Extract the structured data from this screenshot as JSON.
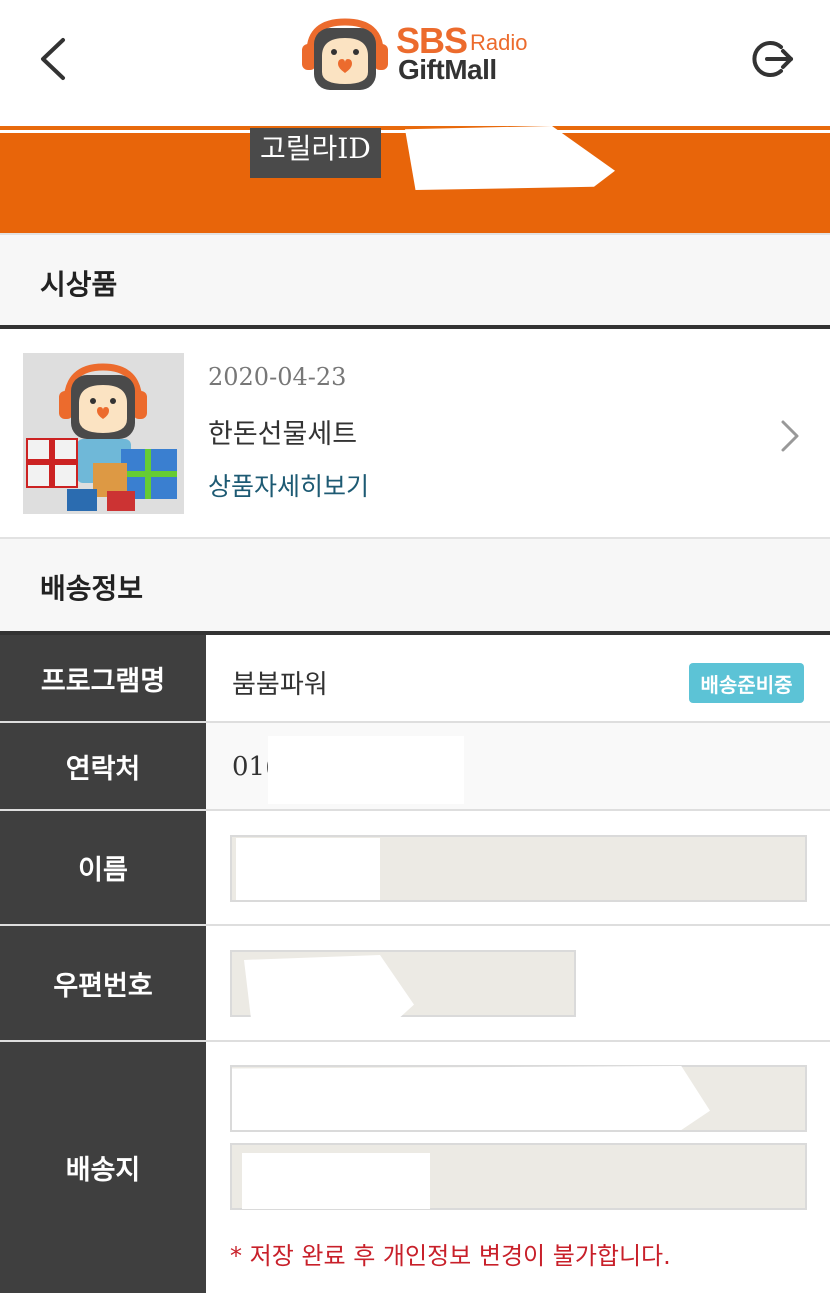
{
  "header": {
    "logo_sbs": "SBS",
    "logo_radio": "Radio",
    "logo_giftmall": "GiftMall",
    "accent_color": "#e8650a"
  },
  "banner": {
    "gorilla_id_label": "고릴라ID"
  },
  "prize_section": {
    "title": "시상품",
    "item": {
      "date": "2020-04-23",
      "name": "한돈선물세트",
      "detail_link": "상품자세히보기"
    }
  },
  "delivery_section": {
    "title": "배송정보",
    "rows": {
      "program": {
        "label": "프로그램명",
        "value": "붐붐파워",
        "status": "배송준비중"
      },
      "contact": {
        "label": "연락처",
        "value": "01("
      },
      "name": {
        "label": "이름"
      },
      "postal": {
        "label": "우편번호"
      },
      "address": {
        "label": "배송지"
      }
    },
    "notice": "* 저장 완료 후 개인정보 변경이 불가합니다."
  },
  "colors": {
    "label_bg": "#3f3f3f",
    "status_badge": "#5cc3d6",
    "notice_text": "#c8202a",
    "link_text": "#1d5a73"
  },
  "icons": [
    "back-arrow-icon",
    "logout-icon",
    "chevron-right-icon",
    "mascot-logo-icon"
  ]
}
